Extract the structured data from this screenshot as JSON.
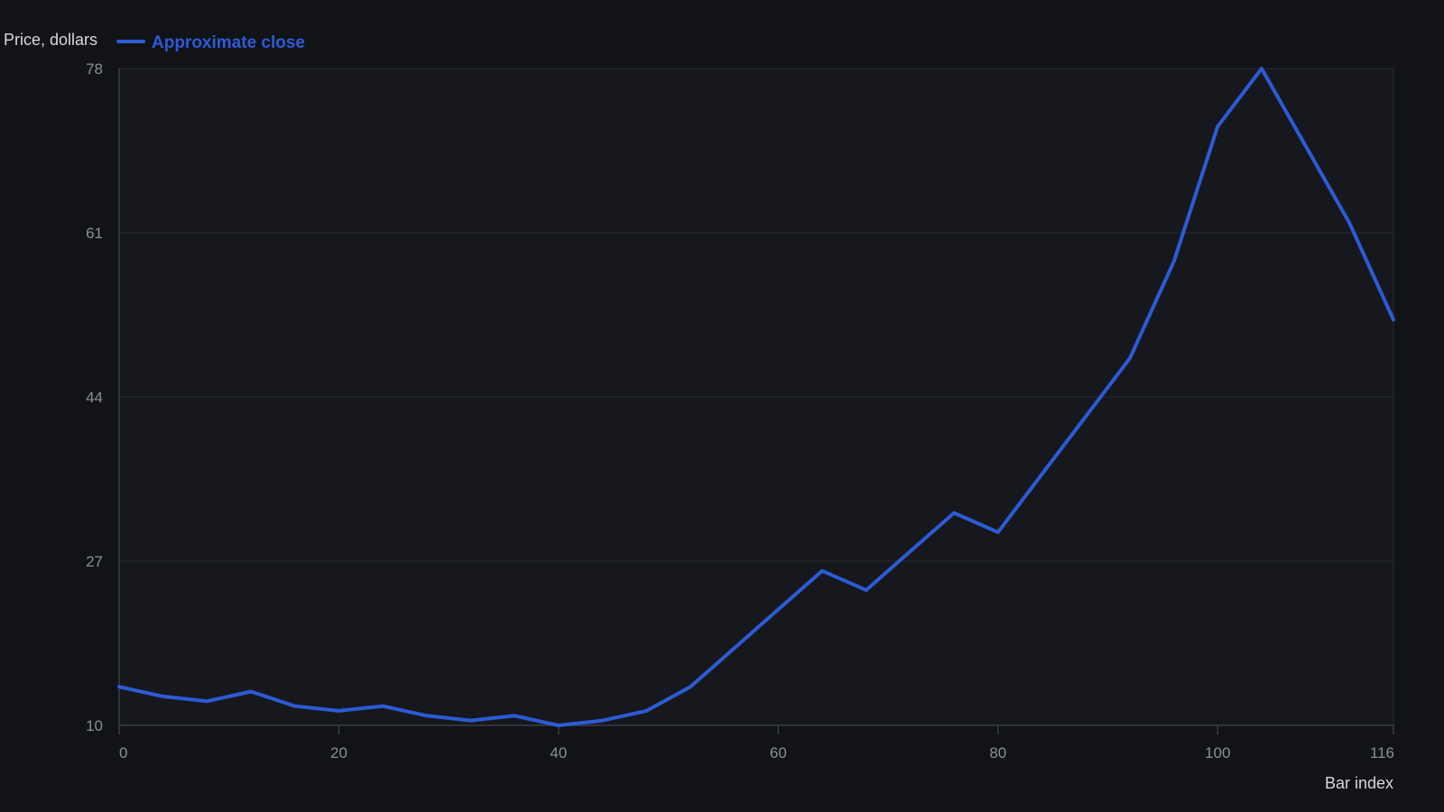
{
  "chart_data": {
    "type": "line",
    "ylabel": "Price, dollars",
    "xlabel": "Bar index",
    "xlim": [
      0,
      116
    ],
    "ylim": [
      10,
      78
    ],
    "x_ticks": [
      0,
      20,
      40,
      60,
      80,
      100,
      116
    ],
    "y_ticks": [
      10,
      27,
      44,
      61,
      78
    ],
    "grid": true,
    "legend_position": "top-left",
    "series": [
      {
        "name": "Approximate close",
        "color": "#2d5bd6",
        "x": [
          0,
          4,
          8,
          12,
          16,
          20,
          24,
          28,
          32,
          36,
          40,
          44,
          48,
          52,
          56,
          60,
          64,
          68,
          72,
          76,
          80,
          84,
          88,
          92,
          96,
          100,
          104,
          108,
          112,
          116
        ],
        "y": [
          14.0,
          13.0,
          12.5,
          13.5,
          12.0,
          11.5,
          12.0,
          11.0,
          10.5,
          11.0,
          10.0,
          10.5,
          11.5,
          14.0,
          18.0,
          22.0,
          26.0,
          24.0,
          28.0,
          32.0,
          30.0,
          36.0,
          42.0,
          48.0,
          58.0,
          72.0,
          78.0,
          70.0,
          62.0,
          52.0
        ]
      }
    ]
  }
}
